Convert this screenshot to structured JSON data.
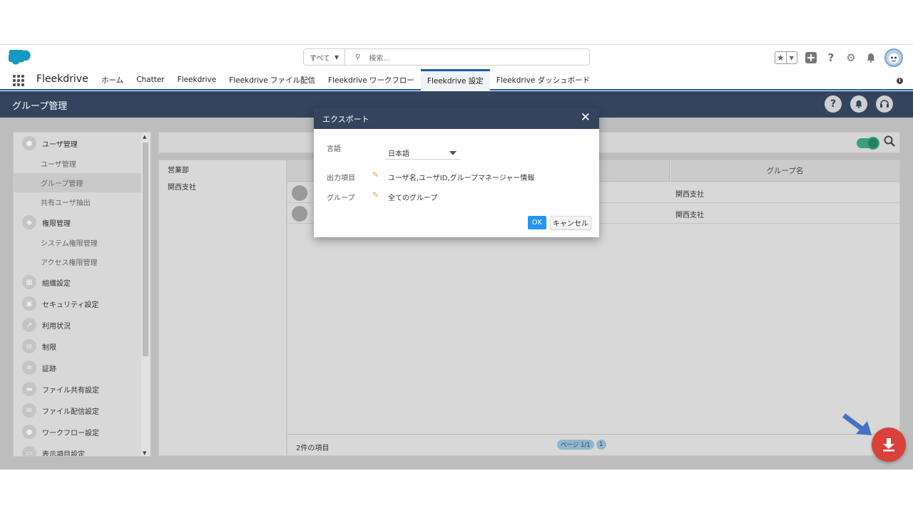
{
  "header": {
    "search_scope": "すべて",
    "search_placeholder": "検索..."
  },
  "nav": {
    "app_name": "Fleekdrive",
    "tabs": [
      {
        "label": "ホーム"
      },
      {
        "label": "Chatter"
      },
      {
        "label": "Fleekdrive"
      },
      {
        "label": "Fleekdrive ファイル配信"
      },
      {
        "label": "Fleekdrive ワークフロー"
      },
      {
        "label": "Fleekdrive 設定",
        "active": true
      },
      {
        "label": "Fleekdrive ダッシュボード"
      }
    ]
  },
  "page": {
    "title": "グループ管理"
  },
  "sidebar": {
    "sections": [
      {
        "label": "ユーザ管理",
        "icon": "user-icon"
      },
      {
        "label": "ユーザ管理",
        "sub": true
      },
      {
        "label": "グループ管理",
        "sub": true,
        "selected": true
      },
      {
        "label": "共有ユーザ抽出",
        "sub": true
      },
      {
        "label": "権限管理",
        "icon": "shield-icon"
      },
      {
        "label": "システム権限管理",
        "sub": true
      },
      {
        "label": "アクセス権限管理",
        "sub": true
      },
      {
        "label": "組織設定",
        "icon": "building-icon"
      },
      {
        "label": "セキュリティ設定",
        "icon": "lock-icon"
      },
      {
        "label": "利用状況",
        "icon": "chart-icon"
      },
      {
        "label": "制限",
        "icon": "minus-circle-icon"
      },
      {
        "label": "証跡",
        "icon": "list-icon"
      },
      {
        "label": "ファイル共有設定",
        "icon": "folder-icon"
      },
      {
        "label": "ファイル配信設定",
        "icon": "mail-icon"
      },
      {
        "label": "ワークフロー設定",
        "icon": "workflow-icon"
      },
      {
        "label": "表示項目設定",
        "icon": "display-icon"
      }
    ]
  },
  "groups": {
    "items": [
      "営業部",
      "関西支社"
    ]
  },
  "table": {
    "header_group": "グループ名",
    "rows": [
      {
        "group": "関西支社"
      },
      {
        "group": "関西支社"
      }
    ],
    "count": "2件の項目",
    "page_label": "ページ 1/1",
    "page_number": "1"
  },
  "modal": {
    "title": "エクスポート",
    "language_label": "言語",
    "language_value": "日本語",
    "output_label": "出力項目",
    "output_value": "ユーザ名,ユーザID,グループマネージャー情報",
    "group_label": "グループ",
    "group_value": "全てのグループ",
    "ok_label": "OK",
    "cancel_label": "キャンセル"
  },
  "colors": {
    "page_header": "#34445e",
    "accent": "#1b5fa8",
    "download_button": "#d9413a",
    "ok_button": "#2196f3"
  }
}
